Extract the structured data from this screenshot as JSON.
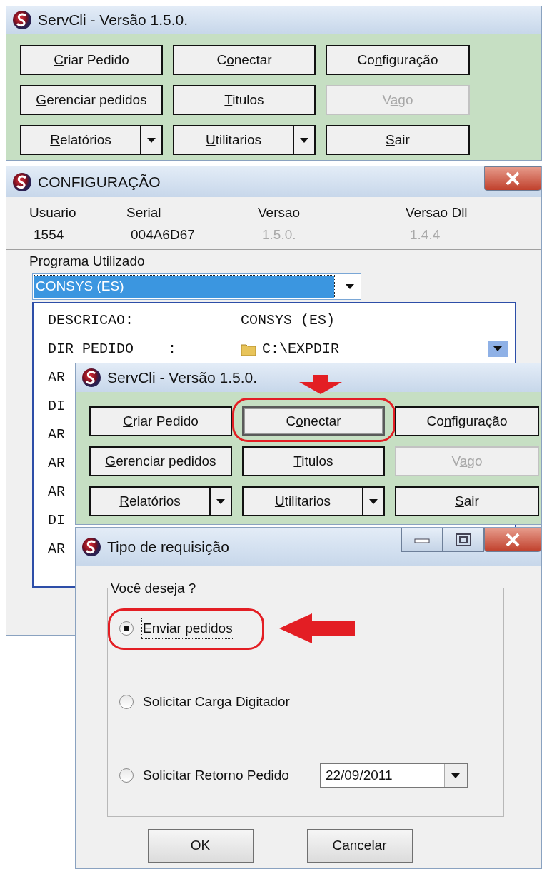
{
  "windows": [
    {
      "kind": "main",
      "title": "ServCli - Versão 1.5.0.",
      "buttons": [
        {
          "kind": "button",
          "key": "C",
          "post": "riar Pedido",
          "disabled": false,
          "focused": false,
          "circled": false,
          "pointed": false
        },
        {
          "kind": "button",
          "pre": "C",
          "key": "o",
          "post": "nectar",
          "disabled": false,
          "focused": false,
          "circled": false,
          "pointed": false
        },
        {
          "kind": "button",
          "pre": "Co",
          "key": "n",
          "post": "figuração",
          "disabled": false,
          "focused": false,
          "circled": false,
          "pointed": false
        },
        {
          "kind": "button",
          "key": "G",
          "post": "erenciar pedidos",
          "disabled": false,
          "focused": false,
          "circled": false,
          "pointed": false
        },
        {
          "kind": "button",
          "key": "T",
          "post": "itulos",
          "disabled": false,
          "focused": false,
          "circled": false,
          "pointed": false
        },
        {
          "kind": "button",
          "pre": "V",
          "key": "a",
          "post": "go",
          "disabled": true,
          "focused": false,
          "circled": false,
          "pointed": false
        },
        {
          "kind": "split",
          "key": "R",
          "post": "elatórios",
          "disabled": false,
          "focused": false,
          "circled": false,
          "pointed": false
        },
        {
          "kind": "split",
          "key": "U",
          "post": "tilitarios",
          "disabled": false,
          "focused": false,
          "circled": false,
          "pointed": false
        },
        {
          "kind": "button",
          "key": "S",
          "post": "air",
          "disabled": false,
          "focused": false,
          "circled": false,
          "pointed": false
        }
      ]
    },
    {
      "kind": "config",
      "title": "CONFIGURAÇÃO",
      "close": true,
      "fields": [
        {
          "label": "Usuario",
          "value": "1554",
          "disabled": false
        },
        {
          "label": "Serial",
          "value": "004A6D67",
          "disabled": false
        },
        {
          "label": "Versao",
          "value": "1.5.0.",
          "disabled": true
        },
        {
          "label": "Versao Dll",
          "value": "1.4.4",
          "disabled": true
        }
      ],
      "program_label": "Programa Utilizado",
      "program": {
        "value": "CONSYS (ES)",
        "highlighted": true
      },
      "details": [
        {
          "kind": "text",
          "key": "DESCRICAO:",
          "value": "CONSYS (ES)"
        },
        {
          "kind": "folder",
          "key": "DIR PEDIDO    :",
          "value": "C:\\EXPDIR"
        },
        {
          "kind": "partial",
          "key": "AR"
        },
        {
          "kind": "partial",
          "key": "DI"
        },
        {
          "kind": "partial",
          "key": "AR"
        },
        {
          "kind": "partial",
          "key": "AR"
        },
        {
          "kind": "partial",
          "key": "AR"
        },
        {
          "kind": "partial",
          "key": "DI"
        },
        {
          "kind": "partial",
          "key": "AR"
        }
      ]
    },
    {
      "kind": "main",
      "title": "ServCli - Versão 1.5.0.",
      "buttons": [
        {
          "kind": "button",
          "key": "C",
          "post": "riar Pedido",
          "disabled": false,
          "focused": false,
          "circled": false,
          "pointed": false
        },
        {
          "kind": "button",
          "pre": "C",
          "key": "o",
          "post": "nectar",
          "disabled": false,
          "focused": true,
          "circled": true,
          "pointed": true
        },
        {
          "kind": "button",
          "pre": "Co",
          "key": "n",
          "post": "figuração",
          "disabled": false,
          "focused": false,
          "circled": false,
          "pointed": false
        },
        {
          "kind": "button",
          "key": "G",
          "post": "erenciar pedidos",
          "disabled": false,
          "focused": false,
          "circled": false,
          "pointed": false
        },
        {
          "kind": "button",
          "key": "T",
          "post": "itulos",
          "disabled": false,
          "focused": false,
          "circled": false,
          "pointed": false
        },
        {
          "kind": "button",
          "pre": "V",
          "key": "a",
          "post": "go",
          "disabled": true,
          "focused": false,
          "circled": false,
          "pointed": false
        },
        {
          "kind": "split",
          "key": "R",
          "post": "elatórios",
          "disabled": false,
          "focused": false,
          "circled": false,
          "pointed": false
        },
        {
          "kind": "split",
          "key": "U",
          "post": "tilitarios",
          "disabled": false,
          "focused": false,
          "circled": false,
          "pointed": false
        },
        {
          "kind": "button",
          "key": "S",
          "post": "air",
          "disabled": false,
          "focused": false,
          "circled": false,
          "pointed": false
        }
      ]
    },
    {
      "kind": "dialog",
      "title": "Tipo de requisição",
      "minimize": true,
      "maximize": true,
      "close": true,
      "group_label": "Você deseja ?",
      "options": [
        {
          "label": "Enviar pedidos",
          "selected": true,
          "focused": true,
          "circled": true,
          "pointed": true
        },
        {
          "label": "Solicitar Carga Digitador",
          "selected": false,
          "focused": false,
          "circled": false,
          "pointed": false
        },
        {
          "label": "Solicitar Retorno Pedido",
          "selected": false,
          "focused": false,
          "circled": false,
          "pointed": false,
          "date": "22/09/2011"
        }
      ],
      "buttons": [
        "OK",
        "Cancelar"
      ]
    }
  ]
}
